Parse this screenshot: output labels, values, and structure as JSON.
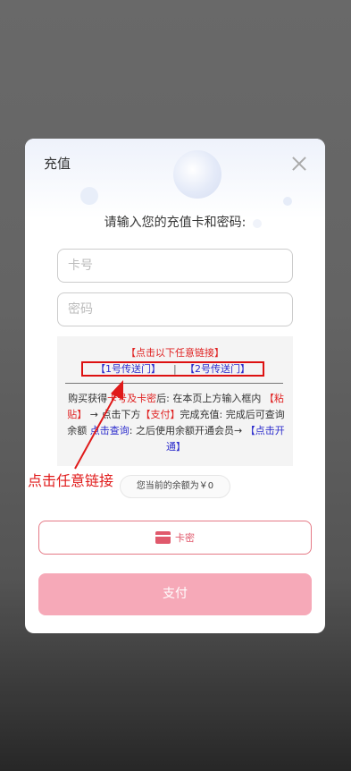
{
  "dialog": {
    "title": "充值",
    "prompt": "请输入您的充值卡和密码:"
  },
  "form": {
    "card_placeholder": "卡号",
    "password_placeholder": "密码"
  },
  "info": {
    "header": "【点击以下任意链接】",
    "link1": "【1号传送门】",
    "separator": "|",
    "link2": "【2号传送门】",
    "instr_a": "购买获得",
    "instr_b": "卡号及卡密",
    "instr_c": "后: 在本页上方输入框内",
    "instr_d": "【粘贴】",
    "instr_e": "→ 点击下方",
    "instr_f": "【支付】",
    "instr_g": "完成充值: 完成后可查询余额",
    "instr_h": "点击查询",
    "instr_i": ": 之后使用余额开通会员→",
    "instr_j": "【点击开通】"
  },
  "balance_text": "您当前的余额为￥0",
  "buttons": {
    "card_label": "卡密",
    "pay_label": "支付"
  },
  "annotation": "点击任意链接",
  "colors": {
    "accent_red": "#e02222",
    "link_blue": "#2b2bcc",
    "pay_pink": "#f6a9b8",
    "card_border": "#e57a86"
  }
}
